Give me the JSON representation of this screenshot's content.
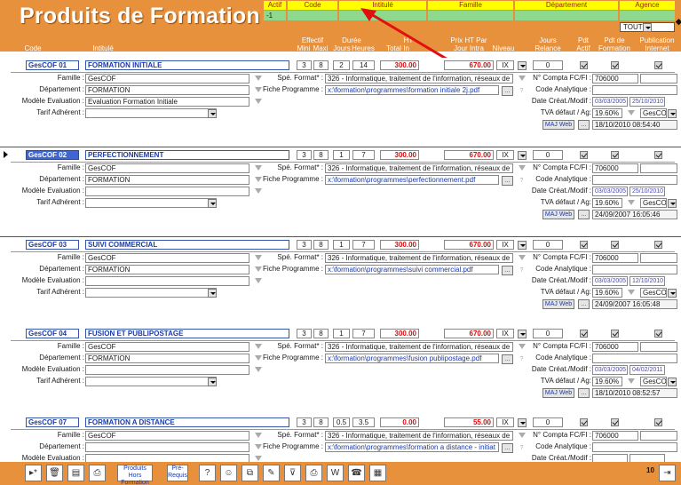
{
  "header": {
    "title": "Produits de Formation",
    "filters": {
      "actif_label": "Actif",
      "actif_value": "-1",
      "code_label": "Code",
      "intitule_label": "Intitulé",
      "famille_label": "Famille",
      "departement_label": "Département",
      "agence_label": "Agence",
      "agence_value": "TOUTES"
    }
  },
  "columns": {
    "code": "Code",
    "intitule": "Intitulé",
    "effectif": "Effectif",
    "mini": "Mini",
    "maxi": "Maxi",
    "duree": "Durée",
    "jours": "Jours",
    "heures": "Heures",
    "prix_ht": "HT",
    "total": "Total In",
    "prix_ht_par": "Prix HT Par",
    "jour_intra": "Jour Intra",
    "niveau": "Niveau",
    "jours_relance_1": "Jours",
    "jours_relance_2": "Relance",
    "pdt_actif_1": "Pdt",
    "pdt_actif_2": "Actif",
    "pdt_formation_1": "Pdt de",
    "pdt_formation_2": "Formation",
    "publication_1": "Publication",
    "publication_2": "Internet"
  },
  "labels": {
    "famille": "Famille :",
    "departement": "Département :",
    "modele": "Modèle Evaluation :",
    "tarif": "Tarif Adhérent :",
    "spe_format": "Spé. Format* :",
    "fiche_programme": "Fiche Programme :",
    "compta": "N° Compta FC/FI :",
    "code_analytique": "Code Analytique :",
    "date_creat": "Date Créat./Modif :",
    "tva": "TVA défaut / Ag:",
    "maj_web": "MAJ Web",
    "ellipsis": "..."
  },
  "records": [
    {
      "code": "GesCOF 01",
      "intitule": "FORMATION INITIALE",
      "mini": "3",
      "maxi": "8",
      "jours": "2",
      "heures": "14",
      "prix_inter": "300.00",
      "prix_intra": "670.00",
      "niveau": "IX",
      "relance": "0",
      "famille": "GesCOF",
      "departement": "FORMATION",
      "modele": "Evaluation Formation Initiale",
      "tarif": "",
      "spe_format": "326 - Informatique, traitement de l'information, réseaux de",
      "fiche": "x:\\formation\\programmes\\formation initiale 2j.pdf",
      "compta": "706000",
      "code_analytique": "",
      "date_creat": "03/03/2005",
      "date_modif": "25/10/2010",
      "tva": "19.60%",
      "agence": "GesCO",
      "maj_date": "18/10/2010 08:54:40",
      "selected": false
    },
    {
      "code": "GesCOF 02",
      "intitule": "PERFECTIONNEMENT",
      "mini": "3",
      "maxi": "8",
      "jours": "1",
      "heures": "7",
      "prix_inter": "300.00",
      "prix_intra": "670.00",
      "niveau": "IX",
      "relance": "0",
      "famille": "GesCOF",
      "departement": "FORMATION",
      "modele": "",
      "tarif": "",
      "spe_format": "326 - Informatique, traitement de l'information, réseaux de",
      "fiche": "x:\\formation\\programmes\\perfectionnement.pdf",
      "compta": "706000",
      "code_analytique": "",
      "date_creat": "03/03/2005",
      "date_modif": "25/10/2010",
      "tva": "19.60%",
      "agence": "GesCO",
      "maj_date": "24/09/2007 16:05:46",
      "selected": true
    },
    {
      "code": "GesCOF 03",
      "intitule": "SUIVI COMMERCIAL",
      "mini": "3",
      "maxi": "8",
      "jours": "1",
      "heures": "7",
      "prix_inter": "300.00",
      "prix_intra": "670.00",
      "niveau": "IX",
      "relance": "0",
      "famille": "GesCOF",
      "departement": "FORMATION",
      "modele": "",
      "tarif": "",
      "spe_format": "326 - Informatique, traitement de l'information, réseaux de",
      "fiche": "x:\\formation\\programmes\\suivi commercial.pdf",
      "compta": "706000",
      "code_analytique": "",
      "date_creat": "03/03/2005",
      "date_modif": "12/10/2010",
      "tva": "19.60%",
      "agence": "GesCO",
      "maj_date": "24/09/2007 16:05:48",
      "selected": false
    },
    {
      "code": "GesCOF 04",
      "intitule": "FUSION ET PUBLIPOSTAGE",
      "mini": "3",
      "maxi": "8",
      "jours": "1",
      "heures": "7",
      "prix_inter": "300.00",
      "prix_intra": "670.00",
      "niveau": "IX",
      "relance": "0",
      "famille": "GesCOF",
      "departement": "FORMATION",
      "modele": "",
      "tarif": "",
      "spe_format": "326 - Informatique, traitement de l'information, réseaux de",
      "fiche": "x:\\formation\\programmes\\fusion publipostage.pdf",
      "compta": "706000",
      "code_analytique": "",
      "date_creat": "03/03/2005",
      "date_modif": "04/02/2011",
      "tva": "19.60%",
      "agence": "GesCO",
      "maj_date": "18/10/2010 08:52:57",
      "selected": false
    },
    {
      "code": "GesCOF 07",
      "intitule": "FORMATION A DISTANCE",
      "mini": "3",
      "maxi": "8",
      "jours": "0.5",
      "heures": "3.5",
      "prix_inter": "0.00",
      "prix_intra": "55.00",
      "niveau": "IX",
      "relance": "0",
      "famille": "GesCOF",
      "departement": "",
      "modele": "",
      "tarif": "",
      "spe_format": "326 - Informatique, traitement de l'information, réseaux de",
      "fiche": "x:\\formation\\programmes\\formation a distance - initiat",
      "compta": "706000",
      "code_analytique": "",
      "date_creat": "",
      "date_modif": "",
      "tva": "",
      "agence": "",
      "maj_date": "",
      "selected": false
    }
  ],
  "footer": {
    "produits_hors": "Produits Hors Formation",
    "pre_requis": "Pré-Requis",
    "record_count": "10"
  },
  "colors": {
    "header_bg": "#e7913c",
    "filter_yellow": "#ffff00",
    "filter_green": "#8fd98f",
    "code_blue": "#1a3aa8",
    "price_red": "#d01010",
    "selected_bg": "#3f66d0"
  }
}
